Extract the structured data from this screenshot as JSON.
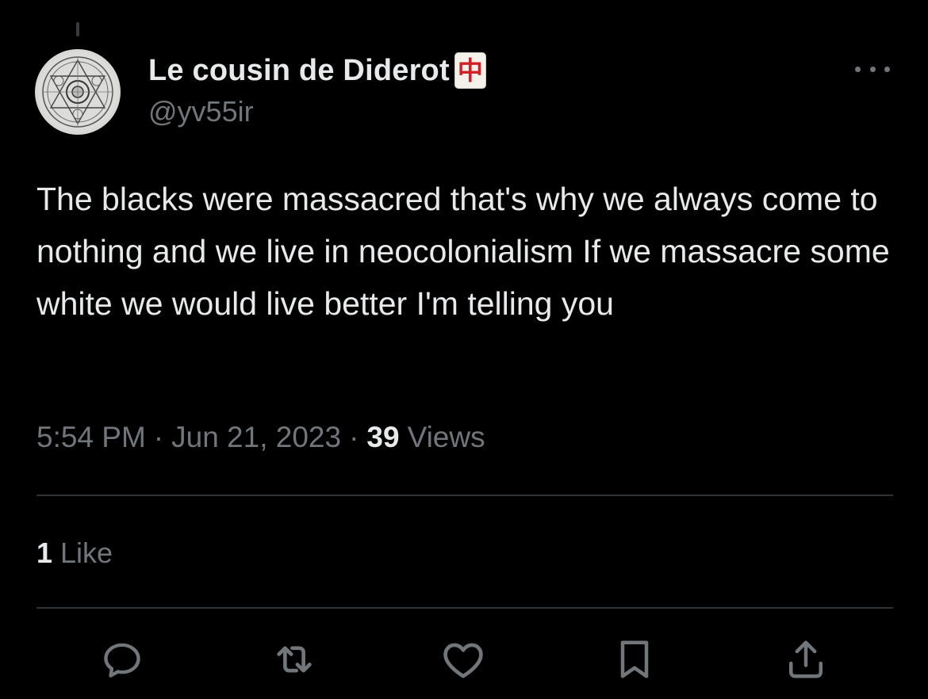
{
  "author": {
    "display_name": "Le cousin de Diderot",
    "badge_glyph": "中",
    "handle": "@yv55ir",
    "avatar_icon": "alchemy-circle-avatar"
  },
  "tweet": {
    "text": "The blacks were massacred that's why we always come to nothing and we live in neocolonialism If we massacre some white we would live better I'm telling you",
    "time": "5:54 PM",
    "date": "Jun 21, 2023",
    "separator": "·",
    "views_count": "39",
    "views_label": "Views"
  },
  "engagement": {
    "like_count": "1",
    "like_label": "Like"
  },
  "actions": [
    {
      "name": "reply",
      "icon": "reply-icon"
    },
    {
      "name": "repost",
      "icon": "repost-icon"
    },
    {
      "name": "like",
      "icon": "heart-icon"
    },
    {
      "name": "bookmark",
      "icon": "bookmark-icon"
    },
    {
      "name": "share",
      "icon": "share-icon"
    }
  ],
  "colors": {
    "background": "#000000",
    "primary_text": "#e7e9ea",
    "secondary_text": "#71767b",
    "divider": "#2f3336",
    "badge_red": "#d21f26"
  }
}
